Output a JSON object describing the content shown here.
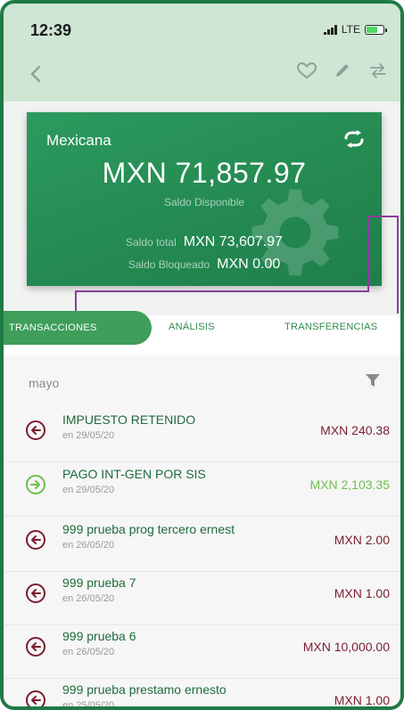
{
  "status_bar": {
    "time": "12:39",
    "network": "LTE"
  },
  "account": {
    "name": "Mexicana",
    "available_balance": "MXN 71,857.97",
    "available_label": "Saldo Disponible",
    "total_label": "Saldo total",
    "total_value": "MXN 73,607.97",
    "blocked_label": "Saldo Bloqueado",
    "blocked_value": "MXN 0.00"
  },
  "tabs": [
    {
      "label": "TRANSACCIONES",
      "active": true
    },
    {
      "label": "ANÁLISIS",
      "active": false
    },
    {
      "label": "TRANSFERENCIAS",
      "active": false
    }
  ],
  "transactions": {
    "month": "mayo",
    "items": [
      {
        "title": "IMPUESTO RETENIDO",
        "date": "en 29/05/20",
        "amount": "MXN 240.38",
        "type": "debit"
      },
      {
        "title": "PAGO INT-GEN POR SIS",
        "date": "en 29/05/20",
        "amount": "MXN 2,103.35",
        "type": "credit"
      },
      {
        "title": "999 prueba prog tercero ernest",
        "date": "en 26/05/20",
        "amount": "MXN 2.00",
        "type": "debit"
      },
      {
        "title": "999 prueba 7",
        "date": "en 26/05/20",
        "amount": "MXN 1.00",
        "type": "debit"
      },
      {
        "title": "999 prueba 6",
        "date": "en 26/05/20",
        "amount": "MXN 10,000.00",
        "type": "debit"
      },
      {
        "title": "999 prueba prestamo ernesto",
        "date": "en 25/05/20",
        "amount": "MXN 1.00",
        "type": "debit"
      }
    ]
  },
  "colors": {
    "brand_green": "#248a52",
    "debit_color": "#7a1e2e",
    "credit_color": "#6ebf4e",
    "annotation_purple": "#8a3f9a"
  },
  "icons": {
    "back": "chevron-left-icon",
    "favorite": "heart-icon",
    "edit": "pencil-icon",
    "transfer": "swap-arrows-icon",
    "card_action": "swap-arrows-icon",
    "filter": "filter-icon",
    "debit": "arrow-left-circle-icon",
    "credit": "arrow-right-circle-icon"
  }
}
